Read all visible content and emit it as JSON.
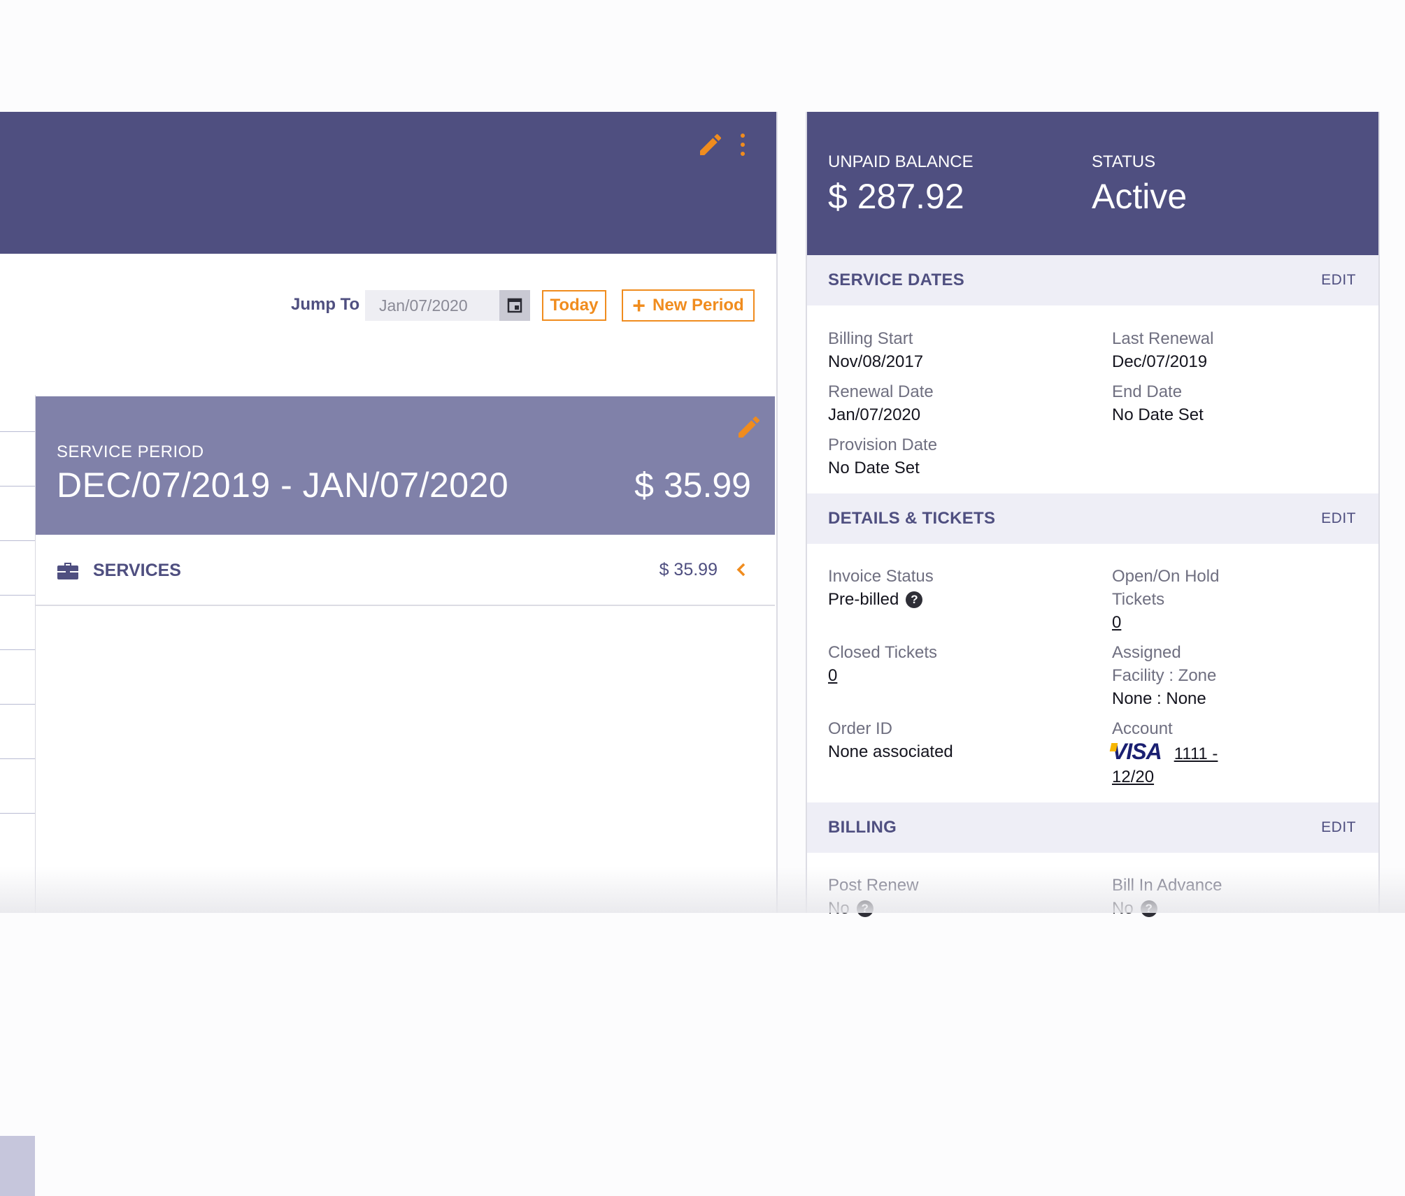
{
  "toolbar": {
    "jump_to_label": "Jump To",
    "date_value": "Jan/07/2020",
    "today_label": "Today",
    "new_period_label": "New Period"
  },
  "service_period": {
    "label": "SERVICE PERIOD",
    "range": "DEC/07/2019 - JAN/07/2020",
    "amount": "$ 35.99"
  },
  "services": {
    "label": "SERVICES",
    "amount": "$ 35.99"
  },
  "summary": {
    "unpaid_label": "UNPAID BALANCE",
    "unpaid_value": "$ 287.92",
    "status_label": "STATUS",
    "status_value": "Active"
  },
  "service_dates": {
    "title": "SERVICE DATES",
    "edit": "EDIT",
    "billing_start_label": "Billing Start",
    "billing_start": "Nov/08/2017",
    "last_renewal_label": "Last Renewal",
    "last_renewal": "Dec/07/2019",
    "renewal_date_label": "Renewal Date",
    "renewal_date": "Jan/07/2020",
    "end_date_label": "End Date",
    "end_date": "No Date Set",
    "provision_date_label": "Provision Date",
    "provision_date": "No Date Set"
  },
  "details": {
    "title": "DETAILS & TICKETS",
    "edit": "EDIT",
    "invoice_status_label": "Invoice Status",
    "invoice_status": "Pre-billed",
    "open_tickets_label_1": "Open/On Hold",
    "open_tickets_label_2": "Tickets",
    "open_tickets": "0",
    "closed_tickets_label": "Closed Tickets",
    "closed_tickets": "0",
    "assigned_label_1": "Assigned",
    "assigned_label_2": "Facility : Zone",
    "assigned": "None : None",
    "order_id_label": "Order ID",
    "order_id": "None associated",
    "account_label": "Account",
    "account_brand": "VISA",
    "account_line1": "1111 -",
    "account_line2": "12/20"
  },
  "billing": {
    "title": "BILLING",
    "edit": "EDIT",
    "post_renew_label": "Post Renew",
    "post_renew": "No",
    "bill_in_advance_label": "Bill In Advance",
    "bill_in_advance": "No"
  },
  "colors": {
    "header": "#4f4f80",
    "period_card": "#8081a9",
    "accent": "#f08c1e",
    "section_bar": "#eeeef6"
  },
  "icons": [
    "pencil-icon",
    "more-vert-icon",
    "calendar-icon",
    "plus-icon",
    "briefcase-icon",
    "chevron-left-icon",
    "help-icon"
  ]
}
